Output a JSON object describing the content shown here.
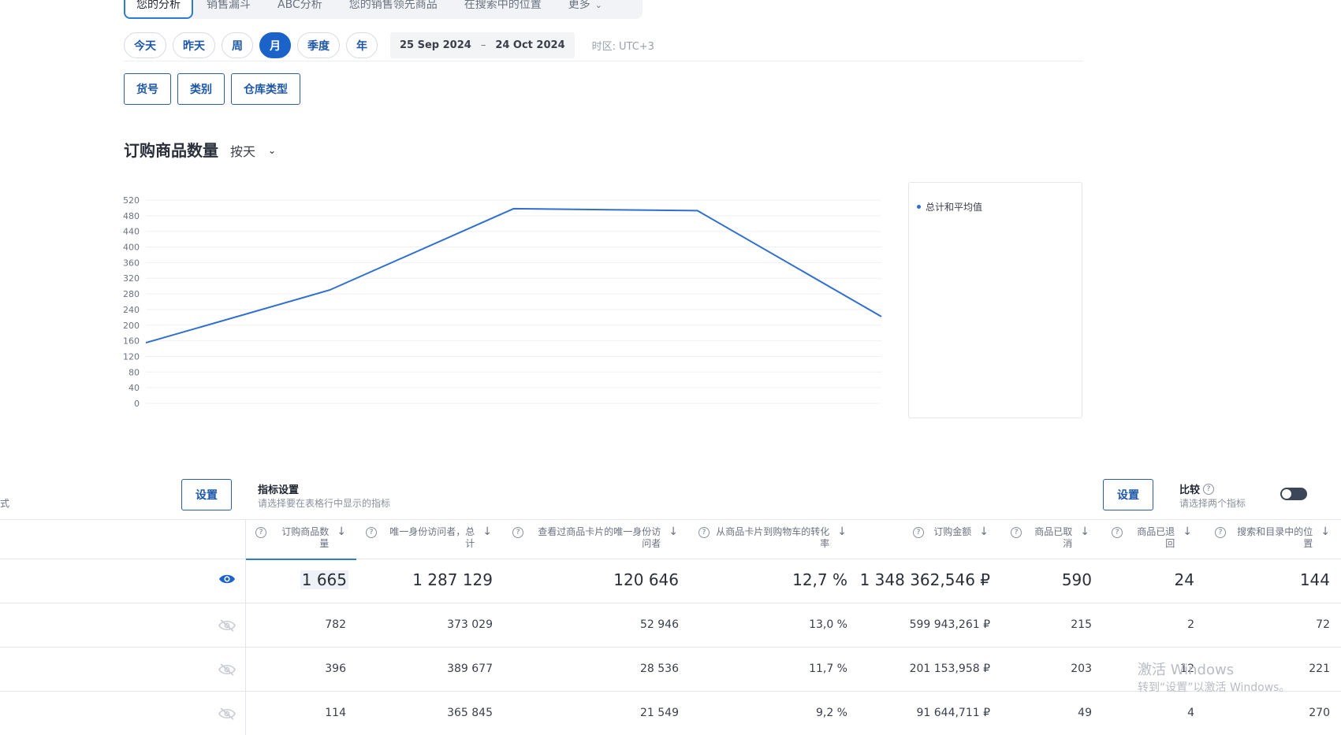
{
  "top_tabs": [
    {
      "label": "您的分析",
      "active": true
    },
    {
      "label": "销售漏斗",
      "active": false
    },
    {
      "label": "ABC分析",
      "active": false
    },
    {
      "label": "您的销售领先商品",
      "active": false
    },
    {
      "label": "在搜索中的位置",
      "active": false
    },
    {
      "label": "更多",
      "active": false
    }
  ],
  "periods": [
    {
      "label": "今天",
      "active": false
    },
    {
      "label": "昨天",
      "active": false
    },
    {
      "label": "周",
      "active": false
    },
    {
      "label": "月",
      "active": true
    },
    {
      "label": "季度",
      "active": false
    },
    {
      "label": "年",
      "active": false
    }
  ],
  "date_range": {
    "start": "25 Sep 2024",
    "separator": "–",
    "end": "24 Oct 2024"
  },
  "timezone": {
    "label": "时区:",
    "value": "UTC+3"
  },
  "filters": [
    "货号",
    "类别",
    "仓库类型"
  ],
  "chart_section": {
    "title": "订购商品数量",
    "granularity": "按天"
  },
  "chart_data": {
    "type": "line",
    "yticks": [
      0,
      40,
      80,
      120,
      160,
      200,
      240,
      280,
      320,
      360,
      400,
      440,
      480,
      520
    ],
    "ylim": [
      0,
      520
    ],
    "x": [
      0,
      1,
      2,
      3,
      4
    ],
    "series": [
      {
        "name": "总计和平均值",
        "values": [
          155,
          290,
          498,
          493,
          222
        ],
        "color": "#2f6fd0"
      }
    ],
    "grid": true,
    "legend": "right"
  },
  "settings": {
    "left_label": "式",
    "left_button": "设置",
    "metric_title": "指标设置",
    "metric_sub": "请选择要在表格行中显示的指标",
    "right_button": "设置",
    "compare_title": "比较",
    "compare_sub": "请选择两个指标",
    "compare_enabled": false
  },
  "table": {
    "columns": [
      "订购商品数量",
      "唯一身份访问者，总计",
      "查看过商品卡片的唯一身份访问者",
      "从商品卡片到购物车的转化率",
      "订购金额",
      "商品已取消",
      "商品已退回",
      "搜索和目录中的位置"
    ],
    "rows": [
      {
        "visible": true,
        "values": [
          "1 665",
          "1 287 129",
          "120 646",
          "12,7 %",
          "1 348 362,546 ₽",
          "590",
          "24",
          "144"
        ]
      },
      {
        "visible": false,
        "values": [
          "782",
          "373 029",
          "52 946",
          "13,0 %",
          "599 943,261 ₽",
          "215",
          "2",
          "72"
        ]
      },
      {
        "visible": false,
        "values": [
          "396",
          "389 677",
          "28 536",
          "11,7 %",
          "201 153,958 ₽",
          "203",
          "12",
          "221"
        ]
      },
      {
        "visible": false,
        "values": [
          "114",
          "365 845",
          "21 549",
          "9,2 %",
          "91 644,711 ₽",
          "49",
          "4",
          "270"
        ]
      }
    ]
  },
  "watermark": {
    "line1": "激活 Windows",
    "line2": "转到“设置”以激活 Windows。"
  }
}
